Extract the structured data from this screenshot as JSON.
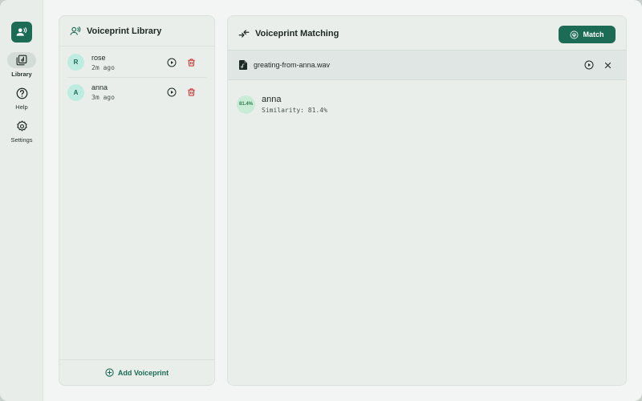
{
  "window": {
    "controls": [
      "close",
      "minimize",
      "zoom"
    ]
  },
  "rail": {
    "logo_icon": "voice-user-icon",
    "items": [
      {
        "label": "Library",
        "icon": "library-icon",
        "active": true
      },
      {
        "label": "Help",
        "icon": "help-icon",
        "active": false
      },
      {
        "label": "Settings",
        "icon": "gear-icon",
        "active": false
      }
    ]
  },
  "library": {
    "title": "Voiceprint Library",
    "icon": "voice-user-icon",
    "items": [
      {
        "initial": "R",
        "name": "rose",
        "time": "2m ago"
      },
      {
        "initial": "A",
        "name": "anna",
        "time": "3m ago"
      }
    ],
    "add_label": "Add Voiceprint"
  },
  "matching": {
    "title": "Voiceprint Matching",
    "icon": "compare-arrows-icon",
    "match_label": "Match",
    "file": {
      "name": "greating-from-anna.wav",
      "icon": "audio-file-icon"
    },
    "result": {
      "score": "81.4%",
      "name": "anna",
      "similarity": "Similarity: 81.4%"
    }
  },
  "colors": {
    "accent": "#1c6b55",
    "danger": "#d0312d",
    "avatar_bg": "#bfece0",
    "score_bg": "#c9ecd6"
  }
}
